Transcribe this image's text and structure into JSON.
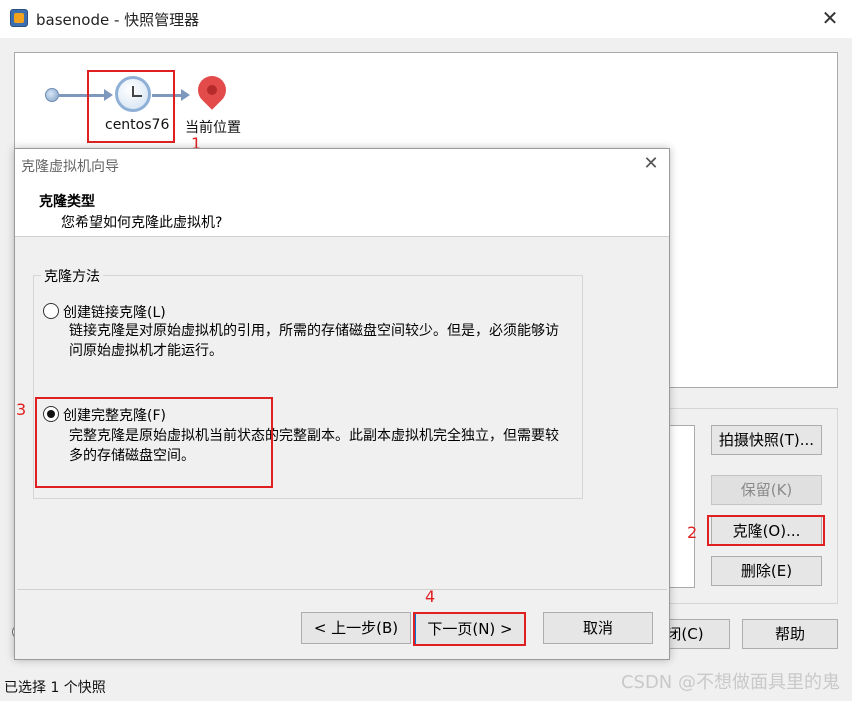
{
  "main": {
    "title": "basenode - 快照管理器",
    "close_glyph": "✕",
    "tree": {
      "snapshot_label": "centos76",
      "current_label": "当前位置"
    },
    "buttons": {
      "take_snapshot": "拍摄快照(T)...",
      "keep": "保留(K)",
      "clone": "克隆(O)...",
      "delete": "删除(E)",
      "close": "闭(C)",
      "help": "帮助"
    },
    "status": "已选择 1 个快照"
  },
  "annotations": {
    "n1": "1",
    "n2": "2",
    "n3": "3",
    "n4": "4",
    "color": "#e02020"
  },
  "wizard": {
    "title": "克隆虚拟机向导",
    "close_glyph": "✕",
    "header_title": "克隆类型",
    "header_subtitle": "您希望如何克隆此虚拟机?",
    "group_label": "克隆方法",
    "options": [
      {
        "label": "创建链接克隆(L)",
        "desc": "链接克隆是对原始虚拟机的引用，所需的存储磁盘空间较少。但是，必须能够访问原始虚拟机才能运行。",
        "checked": false
      },
      {
        "label": "创建完整克隆(F)",
        "desc": "完整克隆是原始虚拟机当前状态的完整副本。此副本虚拟机完全独立，但需要较多的存储磁盘空间。",
        "checked": true
      }
    ],
    "buttons": {
      "back": "< 上一步(B)",
      "next": "下一页(N) >",
      "cancel": "取消"
    }
  },
  "watermark": "CSDN @不想做面具里的鬼",
  "icons": {
    "app": "vmware-icon",
    "snapshot": "clock-icon",
    "current": "location-pin-icon"
  }
}
